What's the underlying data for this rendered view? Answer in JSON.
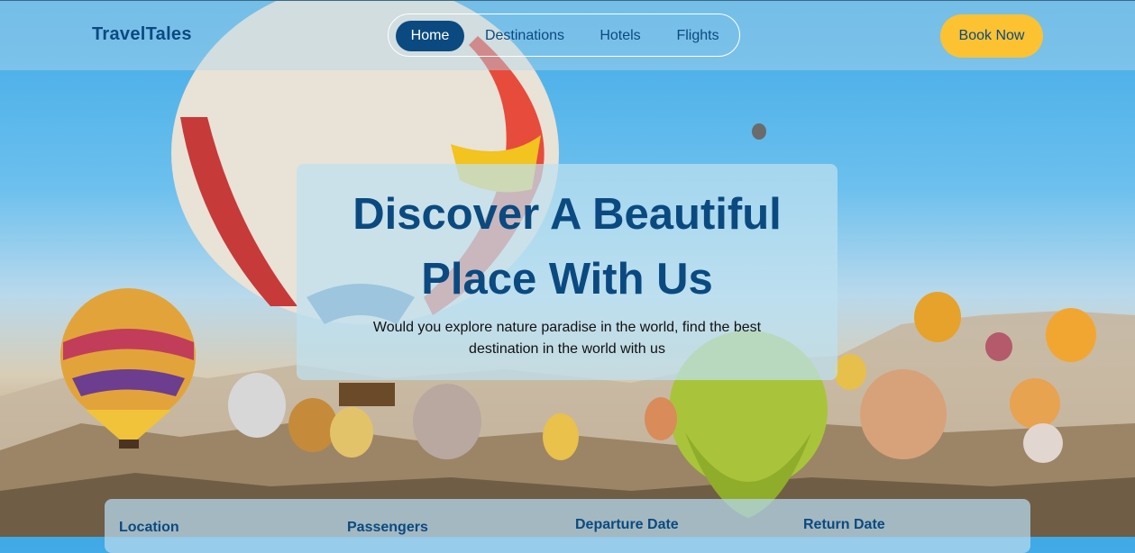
{
  "brand": "TravelTales",
  "nav": {
    "items": [
      {
        "label": "Home",
        "active": true
      },
      {
        "label": "Destinations",
        "active": false
      },
      {
        "label": "Hotels",
        "active": false
      },
      {
        "label": "Flights",
        "active": false
      }
    ],
    "cta_label": "Book Now"
  },
  "hero": {
    "title": "Discover A Beautiful Place With Us",
    "subtitle": "Would you explore nature paradise in the world, find the best destination in the world with us"
  },
  "booking": {
    "fields": [
      {
        "label": "Location"
      },
      {
        "label": "Passengers"
      },
      {
        "label": "Departure Date"
      },
      {
        "label": "Return Date"
      }
    ]
  },
  "colors": {
    "brand": "#0b4a80",
    "accent": "#fcc232",
    "sky": "#3fa9e6"
  }
}
